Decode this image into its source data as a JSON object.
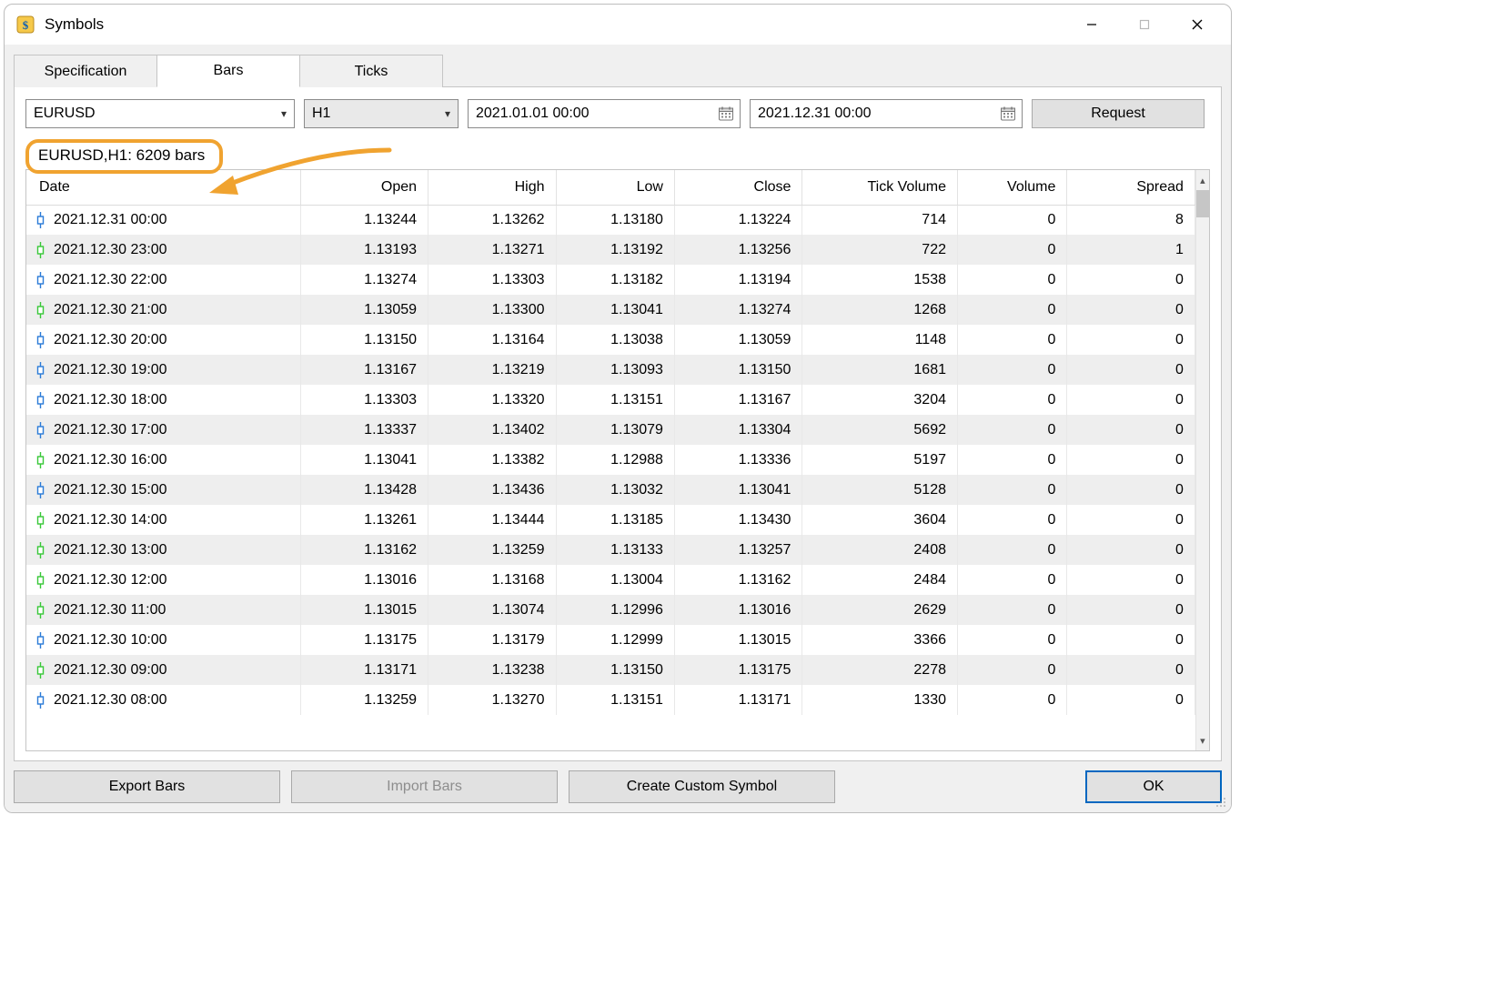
{
  "window": {
    "title": "Symbols"
  },
  "tabs": {
    "specification": "Specification",
    "bars": "Bars",
    "ticks": "Ticks",
    "active": "bars"
  },
  "toolbar": {
    "symbol": "EURUSD",
    "timeframe": "H1",
    "from": "2021.01.01 00:00",
    "to": "2021.12.31 00:00",
    "request_label": "Request"
  },
  "status": {
    "text": "EURUSD,H1: 6209 bars"
  },
  "columns": {
    "date": "Date",
    "open": "Open",
    "high": "High",
    "low": "Low",
    "close": "Close",
    "tickvol": "Tick Volume",
    "vol": "Volume",
    "spread": "Spread"
  },
  "rows": [
    {
      "dir": "down",
      "date": "2021.12.31 00:00",
      "open": "1.13244",
      "high": "1.13262",
      "low": "1.13180",
      "close": "1.13224",
      "tickvol": "714",
      "vol": "0",
      "spread": "8"
    },
    {
      "dir": "up",
      "date": "2021.12.30 23:00",
      "open": "1.13193",
      "high": "1.13271",
      "low": "1.13192",
      "close": "1.13256",
      "tickvol": "722",
      "vol": "0",
      "spread": "1"
    },
    {
      "dir": "down",
      "date": "2021.12.30 22:00",
      "open": "1.13274",
      "high": "1.13303",
      "low": "1.13182",
      "close": "1.13194",
      "tickvol": "1538",
      "vol": "0",
      "spread": "0"
    },
    {
      "dir": "up",
      "date": "2021.12.30 21:00",
      "open": "1.13059",
      "high": "1.13300",
      "low": "1.13041",
      "close": "1.13274",
      "tickvol": "1268",
      "vol": "0",
      "spread": "0"
    },
    {
      "dir": "down",
      "date": "2021.12.30 20:00",
      "open": "1.13150",
      "high": "1.13164",
      "low": "1.13038",
      "close": "1.13059",
      "tickvol": "1148",
      "vol": "0",
      "spread": "0"
    },
    {
      "dir": "down",
      "date": "2021.12.30 19:00",
      "open": "1.13167",
      "high": "1.13219",
      "low": "1.13093",
      "close": "1.13150",
      "tickvol": "1681",
      "vol": "0",
      "spread": "0"
    },
    {
      "dir": "down",
      "date": "2021.12.30 18:00",
      "open": "1.13303",
      "high": "1.13320",
      "low": "1.13151",
      "close": "1.13167",
      "tickvol": "3204",
      "vol": "0",
      "spread": "0"
    },
    {
      "dir": "down",
      "date": "2021.12.30 17:00",
      "open": "1.13337",
      "high": "1.13402",
      "low": "1.13079",
      "close": "1.13304",
      "tickvol": "5692",
      "vol": "0",
      "spread": "0"
    },
    {
      "dir": "up",
      "date": "2021.12.30 16:00",
      "open": "1.13041",
      "high": "1.13382",
      "low": "1.12988",
      "close": "1.13336",
      "tickvol": "5197",
      "vol": "0",
      "spread": "0"
    },
    {
      "dir": "down",
      "date": "2021.12.30 15:00",
      "open": "1.13428",
      "high": "1.13436",
      "low": "1.13032",
      "close": "1.13041",
      "tickvol": "5128",
      "vol": "0",
      "spread": "0"
    },
    {
      "dir": "up",
      "date": "2021.12.30 14:00",
      "open": "1.13261",
      "high": "1.13444",
      "low": "1.13185",
      "close": "1.13430",
      "tickvol": "3604",
      "vol": "0",
      "spread": "0"
    },
    {
      "dir": "up",
      "date": "2021.12.30 13:00",
      "open": "1.13162",
      "high": "1.13259",
      "low": "1.13133",
      "close": "1.13257",
      "tickvol": "2408",
      "vol": "0",
      "spread": "0"
    },
    {
      "dir": "up",
      "date": "2021.12.30 12:00",
      "open": "1.13016",
      "high": "1.13168",
      "low": "1.13004",
      "close": "1.13162",
      "tickvol": "2484",
      "vol": "0",
      "spread": "0"
    },
    {
      "dir": "up",
      "date": "2021.12.30 11:00",
      "open": "1.13015",
      "high": "1.13074",
      "low": "1.12996",
      "close": "1.13016",
      "tickvol": "2629",
      "vol": "0",
      "spread": "0"
    },
    {
      "dir": "down",
      "date": "2021.12.30 10:00",
      "open": "1.13175",
      "high": "1.13179",
      "low": "1.12999",
      "close": "1.13015",
      "tickvol": "3366",
      "vol": "0",
      "spread": "0"
    },
    {
      "dir": "up",
      "date": "2021.12.30 09:00",
      "open": "1.13171",
      "high": "1.13238",
      "low": "1.13150",
      "close": "1.13175",
      "tickvol": "2278",
      "vol": "0",
      "spread": "0"
    },
    {
      "dir": "down",
      "date": "2021.12.30 08:00",
      "open": "1.13259",
      "high": "1.13270",
      "low": "1.13151",
      "close": "1.13171",
      "tickvol": "1330",
      "vol": "0",
      "spread": "0"
    }
  ],
  "footer": {
    "export": "Export Bars",
    "import": "Import Bars",
    "custom": "Create Custom Symbol",
    "ok": "OK"
  },
  "colors": {
    "highlight": "#f0a330",
    "up": "#37c837",
    "down": "#2a7bd8"
  }
}
